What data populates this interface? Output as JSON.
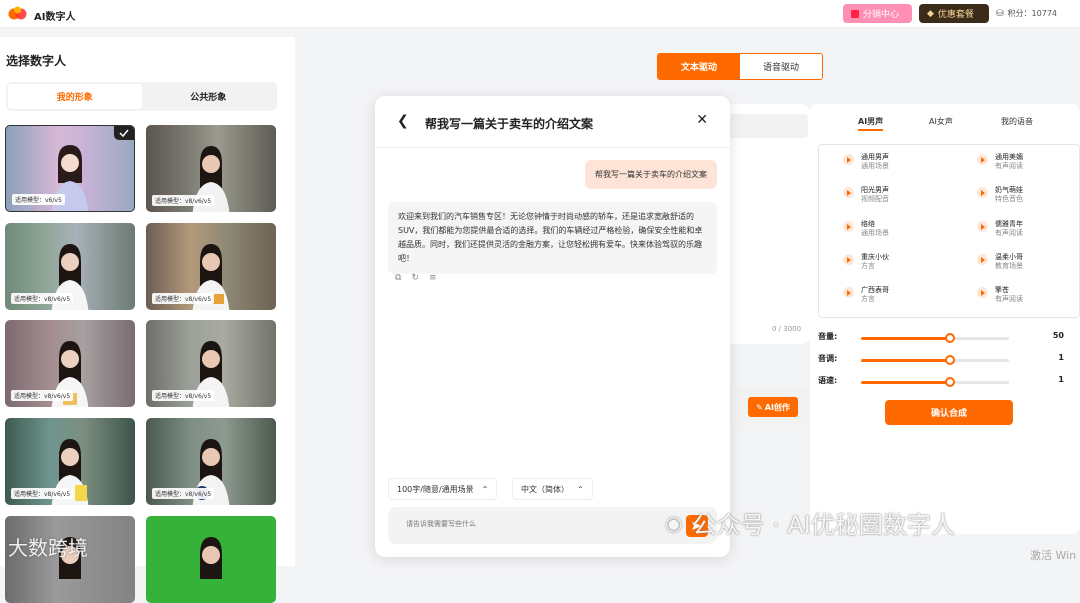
{
  "app": {
    "title": "AI数字人"
  },
  "topbar": {
    "distribution_label": "分销中心",
    "package_label": "优惠套餐",
    "points_label": "积分：10774"
  },
  "sidebar": {
    "title": "选择数字人",
    "tabs": [
      {
        "label": "我的形象",
        "active": true
      },
      {
        "label": "公共形象",
        "active": false
      }
    ],
    "thumbnails": [
      {
        "label": "适用模型：v6/v5",
        "selected": true
      },
      {
        "label": "适用模型：v8/v6/v5",
        "selected": false
      },
      {
        "label": "适用模型：v8/v6/v5",
        "selected": false
      },
      {
        "label": "适用模型：v8/v6/v5",
        "selected": false
      },
      {
        "label": "适用模型：v8/v6/v5",
        "selected": false
      },
      {
        "label": "适用模型：v8/v6/v5",
        "selected": false
      },
      {
        "label": "适用模型：v8/v6/v5",
        "selected": false
      },
      {
        "label": "适用模型：v8/v6/v5",
        "selected": false
      }
    ]
  },
  "mode": {
    "text_drive": "文本驱动",
    "voice_drive": "语音驱动",
    "active": "text_drive"
  },
  "editor": {
    "counter": "0 / 3000",
    "ai_create_label": "AI创作"
  },
  "voice_panel": {
    "tabs": [
      {
        "label": "AI男声",
        "active": true
      },
      {
        "label": "AI女声",
        "active": false
      },
      {
        "label": "我的语音",
        "active": false
      }
    ],
    "voices": [
      {
        "name": "通用男声",
        "desc": "通用场景"
      },
      {
        "name": "通用美媚",
        "desc": "有声阅读"
      },
      {
        "name": "阳光男声",
        "desc": "视频配音"
      },
      {
        "name": "奶气萌娃",
        "desc": "特色音色"
      },
      {
        "name": "络络",
        "desc": "通用场景"
      },
      {
        "name": "儒雅青年",
        "desc": "有声阅读"
      },
      {
        "name": "重庆小伙",
        "desc": "方言"
      },
      {
        "name": "温柔小哥",
        "desc": "教育场景"
      },
      {
        "name": "广西表哥",
        "desc": "方言"
      },
      {
        "name": "擎苍",
        "desc": "有声阅读"
      }
    ],
    "sliders": [
      {
        "label": "音量:",
        "value": "50",
        "fraction": 0.6
      },
      {
        "label": "音调:",
        "value": "1",
        "fraction": 0.6
      },
      {
        "label": "语速:",
        "value": "1",
        "fraction": 0.6
      }
    ],
    "confirm_label": "确认合成"
  },
  "modal": {
    "title": "帮我写一篇关于卖车的介绍文案",
    "user_message": "帮我写一篇关于卖车的介绍文案",
    "ai_message": "欢迎来到我们的汽车销售专区！无论您钟情于时尚动感的轿车，还是追求宽敞舒适的SUV，我们都能为您提供最合适的选择。我们的车辆经过严格检验，确保安全性能和卓越品质。同时，我们还提供灵活的金融方案，让您轻松拥有爱车。快来体验驾驭的乐趣吧！",
    "dropdown_length": "100字/随意/通用场景",
    "dropdown_language": "中文（简体）",
    "input_placeholder": "请告诉我需要写些什么"
  },
  "watermarks": {
    "right": "公众号 · AI优秘圈数字人",
    "left": "大数跨境",
    "activate": "激活 Win"
  },
  "colors": {
    "accent": "#ff6a00",
    "distribution_bg": "#ff8fb3",
    "package_bg": "#3b2c1a"
  }
}
